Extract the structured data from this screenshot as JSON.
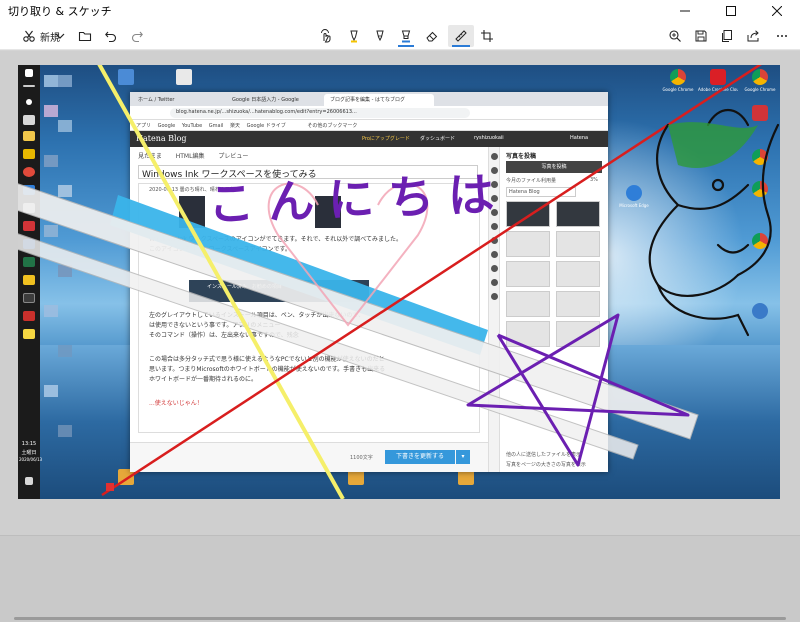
{
  "window": {
    "title": "切り取り & スケッチ"
  },
  "toolbar": {
    "new_label": "新規",
    "icons": [
      "scissors-icon",
      "chevron-down-icon",
      "folder-icon",
      "undo-icon",
      "redo-icon",
      "touch-writing-icon",
      "ballpoint-pen-icon",
      "pencil-icon",
      "highlighter-icon",
      "eraser-icon",
      "ruler-icon",
      "crop-icon",
      "zoom-in-icon",
      "save-icon",
      "copy-icon",
      "share-icon",
      "more-icon"
    ],
    "accent_color": "#2b7bd6",
    "highlighter_color": "#2b7bd6"
  },
  "desktop": {
    "taskbar": {
      "time": "13:15",
      "day": "土曜日",
      "date": "2020/06/13"
    },
    "icons": [
      {
        "label": "Google Chrome"
      },
      {
        "label": "Adobe Creative Cloud"
      },
      {
        "label": "Google Chrome"
      },
      {
        "label": "Microsoft Edge"
      }
    ]
  },
  "browser": {
    "tabs": [
      {
        "label": "ホーム / Twitter"
      },
      {
        "label": "Google 日本語入力 - Google"
      },
      {
        "label": "ブログ記事を編集 - はてなブログ"
      }
    ],
    "url": "blog.hatena.ne.jp/...shizuoka/...hatenablog.com/edit?entry=26006613...",
    "bookmarks": [
      "アプリ",
      "Google",
      "YouTube",
      "Gmail",
      "楽天",
      "Google ドライブ",
      "その他のブックマーク"
    ],
    "hatena_bar": {
      "logo": "Hatena Blog",
      "proupgrade": "Proにアップグレード",
      "dashboard": "ダッシュボード",
      "user": "ryshizuokaii",
      "brand": "Hatena"
    },
    "editor": {
      "tabs": [
        "見たまま",
        "HTML編集",
        "プレビュー"
      ],
      "title": "Windows Ink ワークスペースを使ってみる",
      "date_line": "2020-06-13 曇のち晴れ、晴れの日も。",
      "lines": [
        "Windows Ink ワークスペースのアイコンがでてきます。それで、それ以外で調べてみました。",
        "このアイコンを押すとワークスペースアイコンです。",
        "左のグレイアウトしているインストール項目は、ペン、タッチが出来ないので、",
        "は使用できないという事です。アプリのメニュー",
        "そのコマンド（操作）は、左出来ない事ですので、残念",
        "この場合は多分タッチ式で思う様に使えるようなPCでないと別の機能が使えないのだと",
        "思います。つまりMicrosoftのホワイトボードの機能が使えないのです。手書きも出来る",
        "ホワイトボードが一番期待されるのに。",
        "...使えないじゃん！"
      ],
      "infobox_text": "インストール済み　お勧めの項目",
      "char_count": "1100文字",
      "save_button": "下書きを更新する"
    },
    "side_panel": {
      "title": "写真を投稿",
      "upload_button": "写真を投稿",
      "usage": "今月のファイル利用量",
      "usage_value": "3%",
      "select_label": "Hatena Blog",
      "checkbox_label": "他の人に送信したファイルを表示",
      "footer": "写真をページの大きさの写真を表示"
    }
  },
  "annotations": {
    "handwriting": "こんにちは",
    "pen_colors": {
      "yellow": "#f5ef6a",
      "red": "#d81e1e",
      "purple": "#6b1fb1",
      "blue_highlight": "#3ab4ea",
      "black": "#111111"
    }
  }
}
